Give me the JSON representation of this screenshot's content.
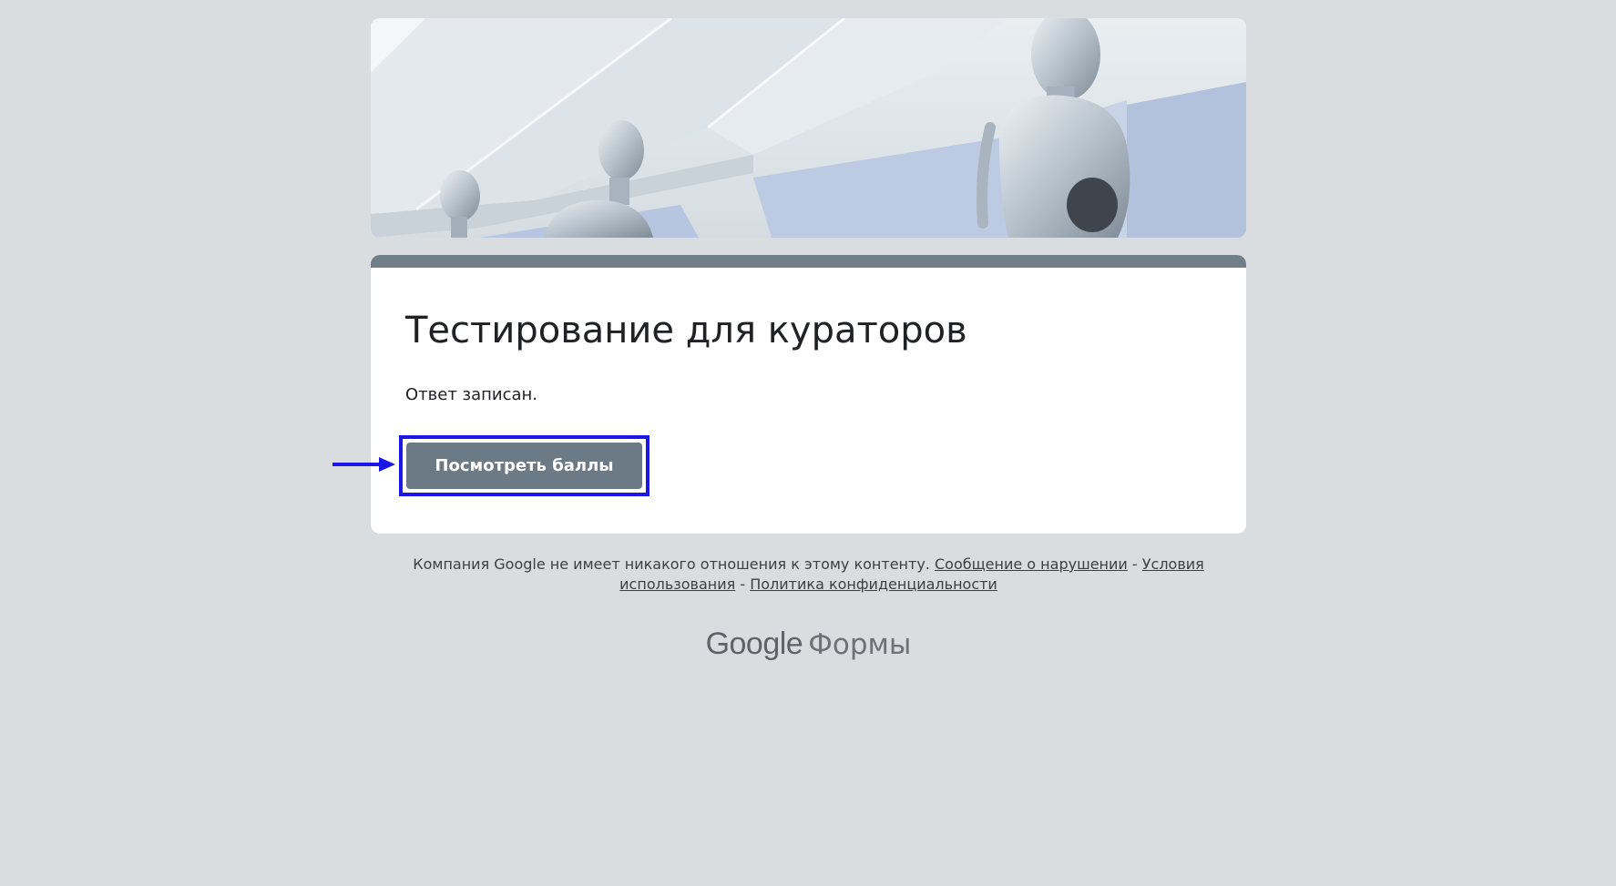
{
  "form": {
    "title": "Тестирование для кураторов",
    "confirmation": "Ответ записан.",
    "view_score_label": "Посмотреть баллы"
  },
  "footer": {
    "disclaimer": "Компания Google не имеет никакого отношения к этому контенту.",
    "report_link": "Сообщение о нарушении",
    "sep1": " - ",
    "terms_link_part1": "Условия",
    "terms_link_part2": "использования",
    "sep2": " - ",
    "privacy_link": "Политика конфиденциальности"
  },
  "branding": {
    "google": "Google",
    "product": "Формы"
  },
  "colors": {
    "page_bg": "#dadde0",
    "card_accent": "#717f88",
    "button_bg": "#6c7a85",
    "highlight_border": "#1b17e9"
  },
  "icons": {
    "annotation_arrow": "arrow-right-icon"
  }
}
